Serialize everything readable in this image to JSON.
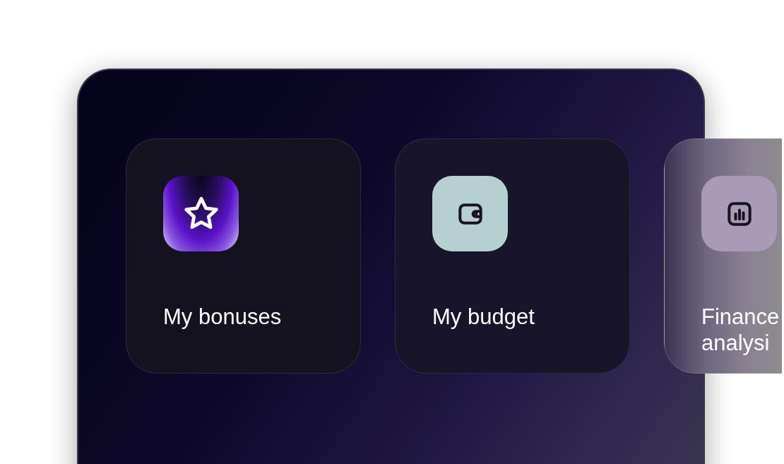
{
  "cards": [
    {
      "label": "My bonuses",
      "kind": "star"
    },
    {
      "label": "My budget",
      "kind": "wallet"
    },
    {
      "label": "Finance analysi",
      "kind": "chart"
    }
  ]
}
